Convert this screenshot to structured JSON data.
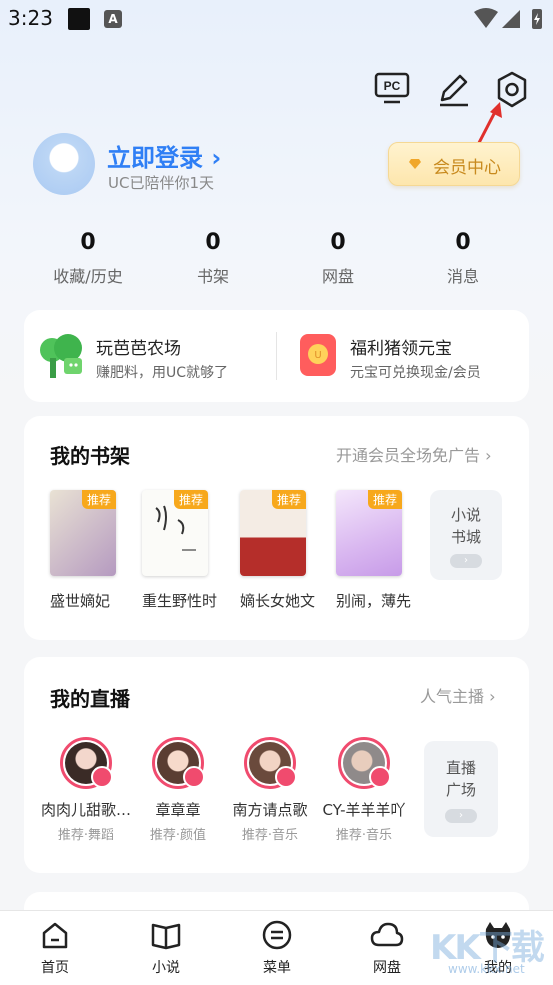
{
  "status_bar": {
    "time": "3:23",
    "badge_letter": "A"
  },
  "header": {
    "pc_label": "PC",
    "icons": [
      "pc-mode-icon",
      "edit-icon",
      "settings-icon"
    ]
  },
  "profile": {
    "login_label": "立即登录",
    "chevron": "›",
    "subtitle": "UC已陪伴你1天",
    "vip_label": "会员中心"
  },
  "stats": [
    {
      "value": "0",
      "label": "收藏/历史"
    },
    {
      "value": "0",
      "label": "书架"
    },
    {
      "value": "0",
      "label": "网盘"
    },
    {
      "value": "0",
      "label": "消息"
    }
  ],
  "promos": [
    {
      "title": "玩芭芭农场",
      "subtitle": "赚肥料，用UC就够了"
    },
    {
      "title": "福利猪领元宝",
      "subtitle": "元宝可兑换现金/会员"
    }
  ],
  "bookshelf": {
    "title": "我的书架",
    "link": "开通会员全场免广告",
    "tag": "推荐",
    "books": [
      {
        "title": "盛世嫡妃"
      },
      {
        "title": "重生野性时"
      },
      {
        "title": "嫡长女她文"
      },
      {
        "title": "别闹，薄先"
      }
    ],
    "more": {
      "line1": "小说",
      "line2": "书城"
    }
  },
  "live": {
    "title": "我的直播",
    "link": "人气主播",
    "hosts": [
      {
        "name": "肉肉儿甜歌…",
        "category": "推荐·舞蹈"
      },
      {
        "name": "章章章",
        "category": "推荐·颜值"
      },
      {
        "name": "南方请点歌",
        "category": "推荐·音乐"
      },
      {
        "name": "CY-羊羊羊吖",
        "category": "推荐·音乐"
      }
    ],
    "more": {
      "line1": "直播",
      "line2": "广场"
    }
  },
  "bottom_nav": [
    {
      "label": "首页"
    },
    {
      "label": "小说"
    },
    {
      "label": "菜单"
    },
    {
      "label": "网盘"
    },
    {
      "label": "我的"
    }
  ],
  "watermark": {
    "main": "KK下载",
    "sub": "www.kkx.net"
  },
  "colors": {
    "accent": "#2f7ff5",
    "vip_gold": "#c88a1e",
    "tag_orange": "#f7a81c",
    "live_pink": "#f04b6e",
    "annotation_red": "#e0302c"
  }
}
